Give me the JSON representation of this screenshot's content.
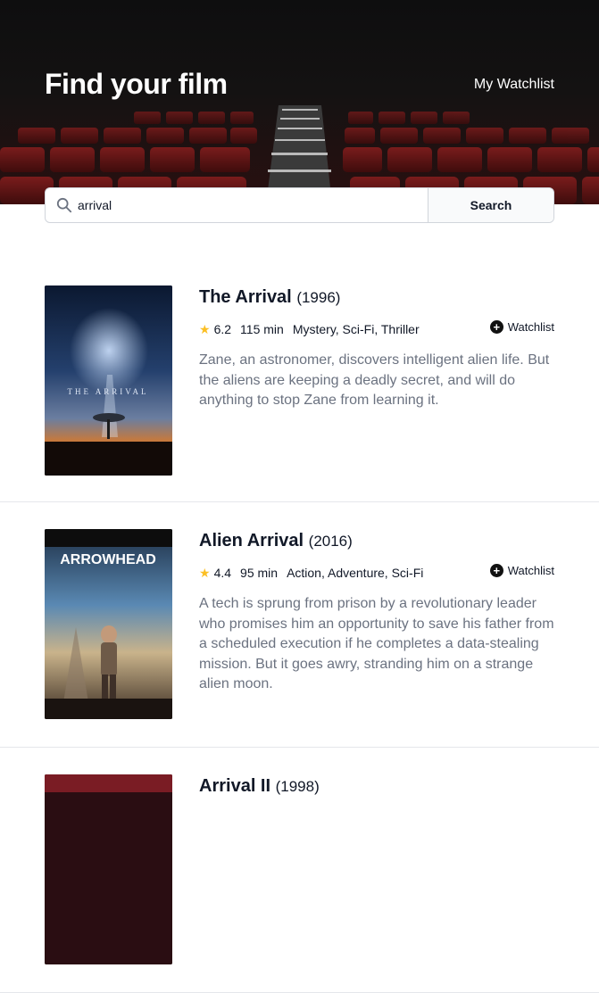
{
  "header": {
    "title": "Find your film",
    "watchlist_link": "My Watchlist"
  },
  "search": {
    "value": "arrival",
    "button_label": "Search",
    "icon": "search-icon"
  },
  "results": [
    {
      "title": "The Arrival",
      "year": "(1996)",
      "rating": "6.2",
      "runtime": "115 min",
      "genres": "Mystery, Sci-Fi, Thriller",
      "watchlist_label": "Watchlist",
      "plot": "Zane, an astronomer, discovers intelligent alien life. But the aliens are keeping a deadly secret, and will do anything to stop Zane from learning it.",
      "poster_text": "THE ARRIVAL"
    },
    {
      "title": "Alien Arrival",
      "year": "(2016)",
      "rating": "4.4",
      "runtime": "95 min",
      "genres": "Action, Adventure, Sci-Fi",
      "watchlist_label": "Watchlist",
      "plot": "A tech is sprung from prison by a revolutionary leader who promises him an opportunity to save his father from a scheduled execution if he completes a data-stealing mission. But it goes awry, stranding him on a strange alien moon.",
      "poster_text": "ARROWHEAD"
    },
    {
      "title": "Arrival II",
      "year": "(1998)"
    }
  ],
  "colors": {
    "star": "#fbbf24",
    "text_muted": "#6b7280",
    "header_bg": "#0f0f10"
  }
}
